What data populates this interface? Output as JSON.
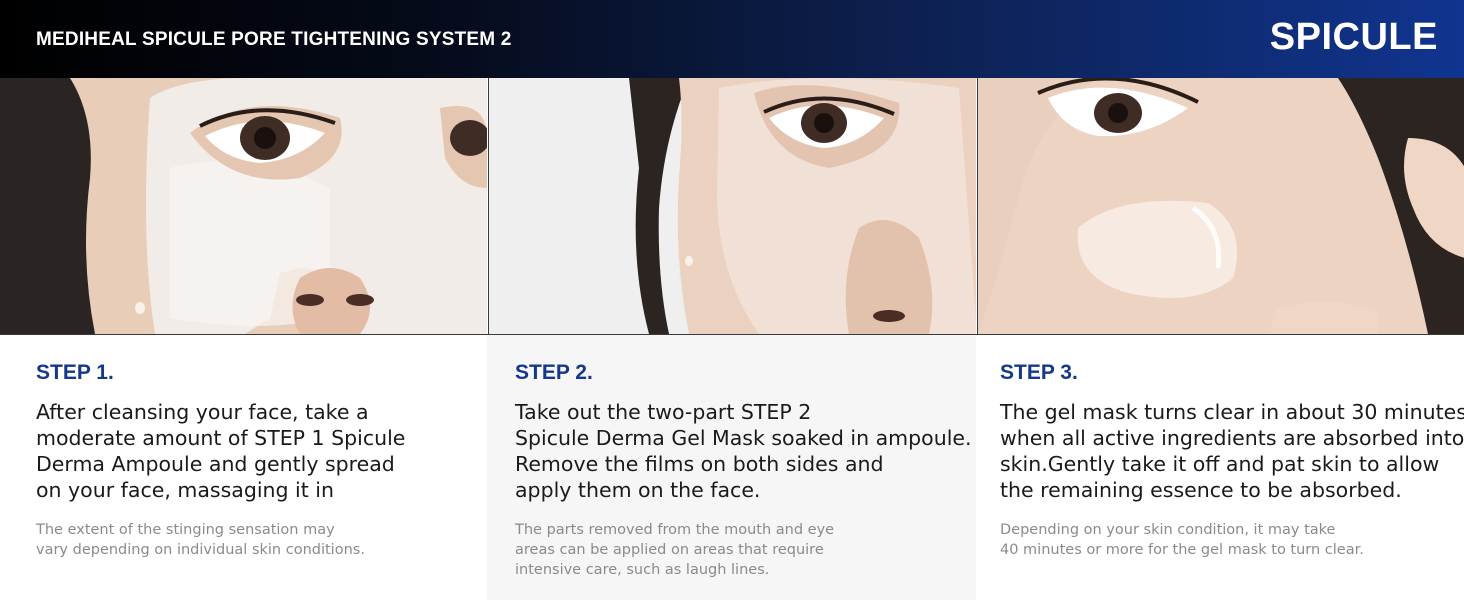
{
  "header": {
    "title": "MEDIHEAL SPICULE PORE TIGHTENING SYSTEM 2",
    "brand": "SPICULE"
  },
  "steps": [
    {
      "label": "STEP 1.",
      "text": [
        "After cleansing your face, take a",
        "moderate amount of STEP 1 Spicule",
        "Derma Ampoule and gently spread",
        "on your face, massaging it in"
      ],
      "note": [
        "The extent of the stinging sensation may",
        "vary depending on individual skin conditions."
      ]
    },
    {
      "label": "STEP 2.",
      "text": [
        "Take out the two-part STEP 2",
        "Spicule Derma Gel Mask soaked in ampoule.",
        "Remove the films on both sides and",
        "apply them on the face."
      ],
      "note": [
        "The parts removed from the mouth and eye",
        "areas can be applied on areas that require",
        "intensive care, such as laugh lines."
      ]
    },
    {
      "label": "STEP 3.",
      "text": [
        "The gel mask turns clear in about 30 minutes",
        "when all active ingredients are absorbed into",
        "skin.Gently take it off and pat skin to allow",
        "the remaining essence to be absorbed."
      ],
      "note": [
        "Depending on your skin condition, it may take",
        "40 minutes or more for the gel mask to turn clear."
      ]
    }
  ],
  "colors": {
    "header_dark": "#000000",
    "header_blue": "#10348f",
    "step_label": "#16388a",
    "note_gray": "#8a8a8a",
    "step2_bg": "#f6f6f6"
  }
}
